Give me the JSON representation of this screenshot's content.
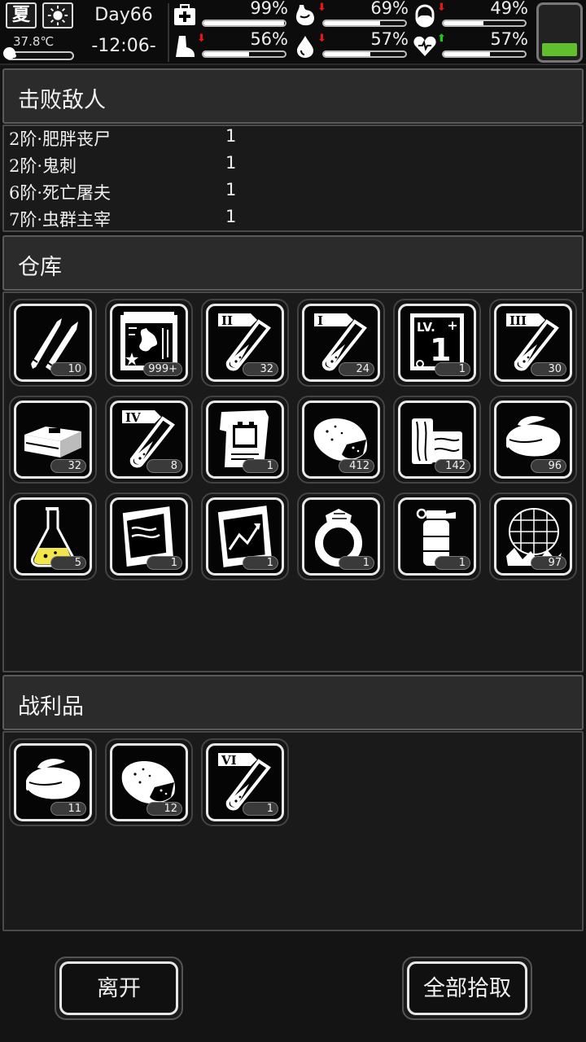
{
  "status": {
    "season": "夏",
    "weather_icon": "sun-icon",
    "temperature": "37.8℃",
    "temperature_level": 0.12,
    "day": "Day66",
    "clock": "-12:06-",
    "battery_level": 0.25,
    "battery_color": "#5fbf2f",
    "stats": [
      {
        "name": "health",
        "icon": "first-aid-icon",
        "value": "99%",
        "level": 0.99,
        "trend": ""
      },
      {
        "name": "hunger",
        "icon": "stomach-icon",
        "value": "69%",
        "level": 0.69,
        "trend": "down"
      },
      {
        "name": "medicine",
        "icon": "pill-icon",
        "value": "49%",
        "level": 0.49,
        "trend": "down"
      },
      {
        "name": "stamina",
        "icon": "foot-icon",
        "value": "56%",
        "level": 0.56,
        "trend": "down"
      },
      {
        "name": "thirst",
        "icon": "water-drop-icon",
        "value": "57%",
        "level": 0.57,
        "trend": "down"
      },
      {
        "name": "mood",
        "icon": "heart-icon",
        "value": "57%",
        "level": 0.57,
        "trend": "up"
      }
    ]
  },
  "defeated": {
    "title": "击败敌人",
    "enemies": [
      {
        "name": "2阶·肥胖丧尸",
        "count": "1"
      },
      {
        "name": "2阶·鬼刺",
        "count": "1"
      },
      {
        "name": "6阶·死亡屠夫",
        "count": "1"
      },
      {
        "name": "7阶·虫群主宰",
        "count": "1"
      }
    ]
  },
  "warehouse": {
    "title": "仓库",
    "items": [
      {
        "icon": "bullets-icon",
        "count": "10"
      },
      {
        "icon": "circuit-map-icon",
        "count": "999+"
      },
      {
        "icon": "test-tube-ii-icon",
        "count": "32"
      },
      {
        "icon": "test-tube-i-icon",
        "count": "24"
      },
      {
        "icon": "skill-book-lv1-icon",
        "count": "1"
      },
      {
        "icon": "test-tube-iii-icon",
        "count": "30"
      },
      {
        "icon": "ammo-box-icon",
        "count": "32"
      },
      {
        "icon": "test-tube-iv-icon",
        "count": "8"
      },
      {
        "icon": "battery-blueprint-icon",
        "count": "1"
      },
      {
        "icon": "raw-meat-icon",
        "count": "412"
      },
      {
        "icon": "wood-planks-icon",
        "count": "142"
      },
      {
        "icon": "cloth-icon",
        "count": "96"
      },
      {
        "icon": "flask-icon",
        "count": "5"
      },
      {
        "icon": "document-icon",
        "count": "1"
      },
      {
        "icon": "chart-document-icon",
        "count": "1"
      },
      {
        "icon": "ring-icon",
        "count": "1"
      },
      {
        "icon": "grenade-icon",
        "count": "1"
      },
      {
        "icon": "net-trap-icon",
        "count": "97"
      }
    ]
  },
  "loot": {
    "title": "战利品",
    "items": [
      {
        "icon": "cloth-icon",
        "count": "11"
      },
      {
        "icon": "raw-meat-icon",
        "count": "12"
      },
      {
        "icon": "test-tube-vi-icon",
        "count": "1"
      }
    ]
  },
  "actions": {
    "leave": "离开",
    "pick_all": "全部拾取"
  },
  "colors": {
    "trend_down": "#e01818",
    "trend_up": "#1ec81e",
    "flask_liquid": "#f2e64a"
  },
  "tube_labels": [
    "I",
    "II",
    "III",
    "IV",
    "VI"
  ],
  "book_label": "LV.",
  "book_level": "1"
}
